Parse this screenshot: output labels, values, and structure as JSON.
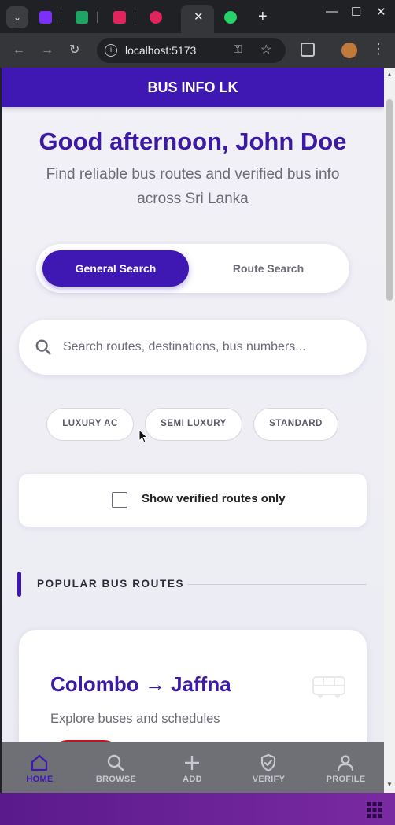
{
  "browser": {
    "tabs": [
      {
        "icon": "docs-icon",
        "color": "#7b2ff7"
      },
      {
        "icon": "sheets-icon",
        "color": "#1fa463"
      },
      {
        "icon": "pdf-icon",
        "color": "#e0245e"
      },
      {
        "icon": "canva-icon",
        "color": "#e0245e"
      }
    ],
    "active_tab_close": "✕",
    "whatsapp_icon": "whatsapp-icon",
    "new_tab": "+",
    "url": "localhost:5173"
  },
  "app": {
    "title": "BUS INFO LK",
    "greeting": "Good afternoon, John Doe",
    "subtitle": "Find reliable bus routes and verified bus info across Sri Lanka",
    "search_mode": {
      "options": [
        "General Search",
        "Route Search"
      ],
      "selected": "General Search"
    },
    "search": {
      "placeholder": "Search routes, destinations, bus numbers...",
      "value": ""
    },
    "filters": [
      "LUXURY AC",
      "SEMI LUXURY",
      "STANDARD"
    ],
    "verified_toggle": {
      "label": "Show verified routes only",
      "checked": false
    },
    "section_title": "POPULAR BUS ROUTES",
    "route_card": {
      "route": "Colombo → Jaffna",
      "description": "Explore buses and schedules"
    },
    "nav": [
      {
        "label": "HOME",
        "icon": "home-icon",
        "active": true
      },
      {
        "label": "BROWSE",
        "icon": "search-icon",
        "active": false
      },
      {
        "label": "ADD",
        "icon": "plus-icon",
        "active": false
      },
      {
        "label": "VERIFY",
        "icon": "shield-check-icon",
        "active": false
      },
      {
        "label": "PROFILE",
        "icon": "user-icon",
        "active": false
      }
    ]
  },
  "colors": {
    "brand": "#3f17b3",
    "accent_red": "#c4101c",
    "nav_bg": "#6f6f76"
  }
}
